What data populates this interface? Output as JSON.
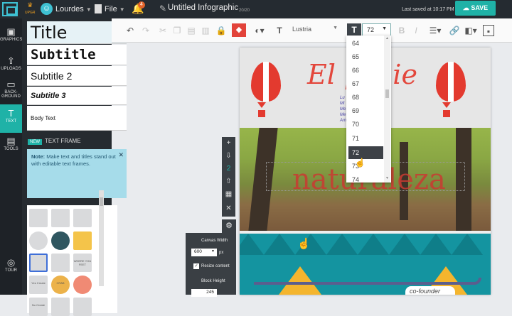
{
  "topbar": {
    "crown_label": "UPGR",
    "user": "Lourdes",
    "file": "File",
    "notif_count": "4",
    "title": "Untitled Infographic",
    "counter": "20/20",
    "last_saved": "Last saved at 10:17 PM",
    "save": "SAVE"
  },
  "rail": {
    "graphics": "GRAPHICS",
    "uploads": "UPLOADS",
    "background": "BACK-\nGROUND",
    "text": "TEXT",
    "tools": "TOOLS",
    "tour": "TOUR"
  },
  "panel": {
    "styles": [
      "Title",
      "Subtitle",
      "Subtitle 2",
      "Subtitle 3",
      "Body Text"
    ],
    "new": "NEW",
    "text_frame": "TEXT FRAME",
    "note_bold": "Note:",
    "note": " Make text and titles stand out with editable text frames.",
    "thumbs": [
      "",
      "",
      "",
      "",
      "",
      "",
      "",
      "",
      "WHERE YOU FEET",
      "",
      "",
      "",
      "Yes Create",
      "CRAB",
      "",
      "No Create",
      "",
      ""
    ]
  },
  "toolbar": {
    "font": "Lustria",
    "font_size": "72"
  },
  "dropdown": {
    "options": [
      "64",
      "65",
      "66",
      "67",
      "68",
      "69",
      "70",
      "71",
      "72",
      "73",
      "74"
    ],
    "selected": "72"
  },
  "canvas": {
    "title": "El p",
    "title_end": "ie",
    "blue_lines": [
      "Lu",
      "Mi",
      "Me",
      "Me",
      "Am"
    ],
    "photo_text": "naturaleza",
    "cofounder": "co-founder"
  },
  "props": {
    "canvas_width_label": "Canvas Width",
    "canvas_width": "600",
    "px": "px",
    "resize": "Resize content",
    "block_height_label": "Block Height",
    "block_height": "245",
    "check": "✓"
  },
  "colors": {
    "accent": "#1fb2a7",
    "topbar": "#252b31",
    "balloon": "#e33a2f",
    "title_red": "#e3473c",
    "note_bg": "#a6dcea"
  }
}
